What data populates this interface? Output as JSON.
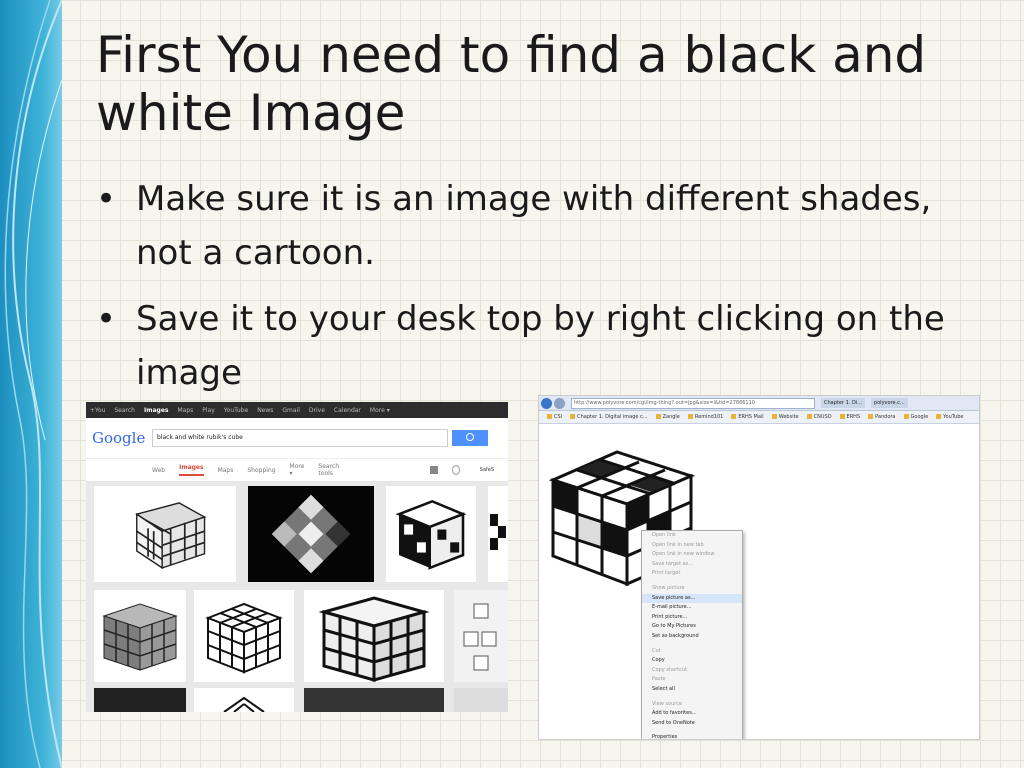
{
  "slide": {
    "title": "First You need to find a black and white Image",
    "bullets": [
      "Make sure it is an image with different shades, not a cartoon.",
      "Save it to your desk top by right clicking on the image"
    ],
    "bullet_glyph": "•",
    "accent_color": "#2a9fd0"
  },
  "google_screenshot": {
    "topbar": [
      "+You",
      "Search",
      "Images",
      "Maps",
      "Play",
      "YouTube",
      "News",
      "Gmail",
      "Drive",
      "Calendar",
      "More ▾"
    ],
    "logo": "Google",
    "query": "black and white rubik's cube",
    "tabs": [
      "Web",
      "Images",
      "Maps",
      "Shopping",
      "More ▾",
      "Search tools"
    ],
    "safe": "SafeS",
    "icons": [
      "camera-icon",
      "search-icon",
      "gear-icon"
    ]
  },
  "browser_screenshot": {
    "address": "http://www.polyvore.com/cgi/img-thing?.out=jpg&size=l&tid=27866110",
    "tabs": [
      "Chapter 1. Di...",
      "polyvore.c..."
    ],
    "favorites": [
      "CSI",
      "Chapter 1. Digital image c...",
      "Zangle",
      "Remind101",
      "ERHS Mail",
      "Website",
      "CNUSD",
      "ERHS",
      "Pandora",
      "Google",
      "YouTube"
    ],
    "context_menu": [
      {
        "label": "Open link",
        "dim": true
      },
      {
        "label": "Open link in new tab",
        "dim": true
      },
      {
        "label": "Open link in new window",
        "dim": true
      },
      {
        "label": "Save target as...",
        "dim": true
      },
      {
        "label": "Print target",
        "dim": true
      },
      {
        "label": "Show picture",
        "dim": true,
        "gap": true
      },
      {
        "label": "Save picture as...",
        "dim": false,
        "highlight": true
      },
      {
        "label": "E-mail picture...",
        "dim": false
      },
      {
        "label": "Print picture...",
        "dim": false
      },
      {
        "label": "Go to My Pictures",
        "dim": false
      },
      {
        "label": "Set as background",
        "dim": false
      },
      {
        "label": "Cut",
        "dim": true,
        "gap": true
      },
      {
        "label": "Copy",
        "dim": false
      },
      {
        "label": "Copy shortcut",
        "dim": true
      },
      {
        "label": "Paste",
        "dim": true
      },
      {
        "label": "Select all",
        "dim": false
      },
      {
        "label": "View source",
        "dim": true,
        "gap": true
      },
      {
        "label": "Add to favorites...",
        "dim": false
      },
      {
        "label": "Send to OneNote",
        "dim": false
      },
      {
        "label": "Properties",
        "dim": false,
        "gap": true
      }
    ]
  }
}
